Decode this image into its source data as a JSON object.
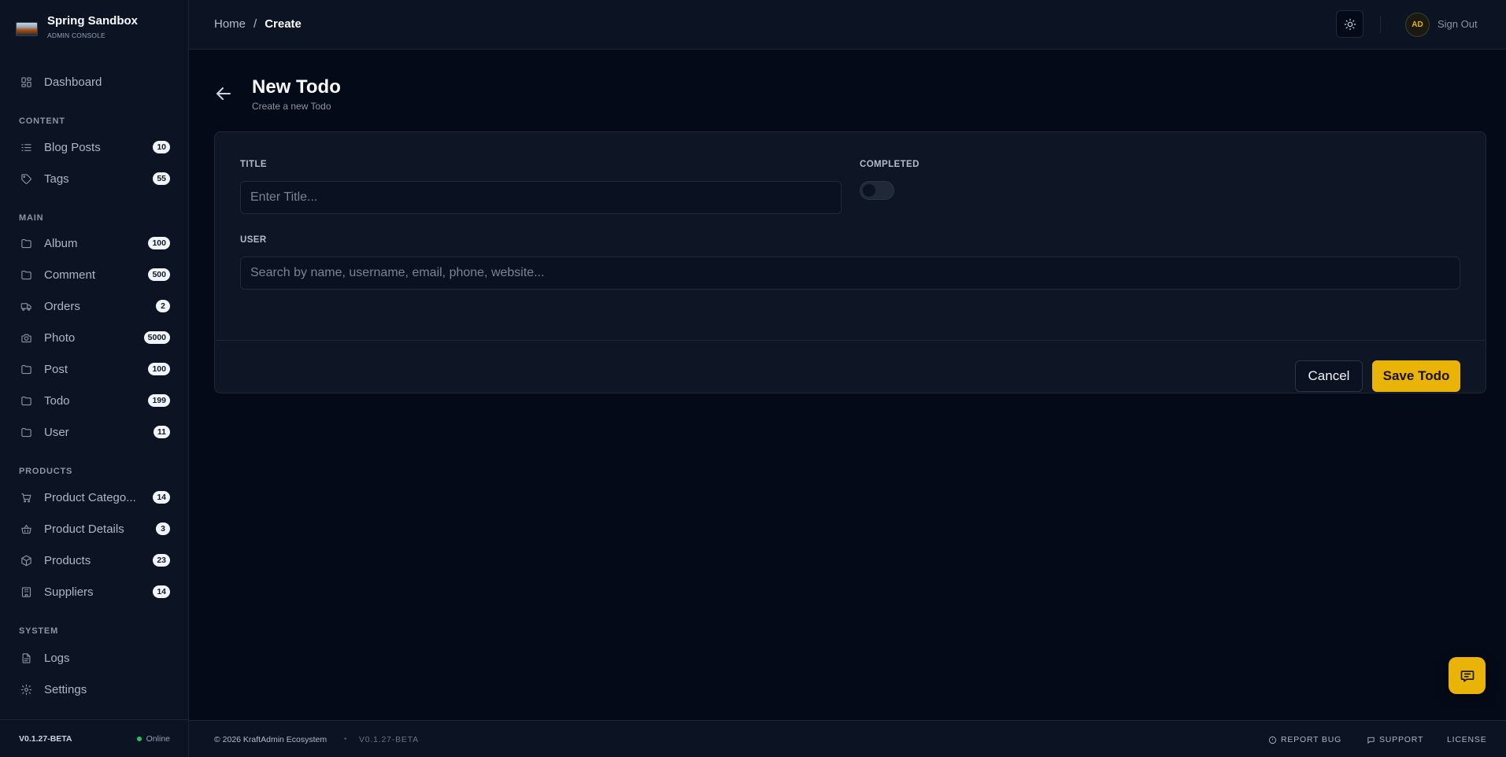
{
  "brand": {
    "title": "Spring Sandbox",
    "subtitle": "ADMIN CONSOLE"
  },
  "sidebar": {
    "dashboard": {
      "label": "Dashboard",
      "icon": "layout-grid-icon"
    },
    "sections": [
      {
        "title": "CONTENT",
        "items": [
          {
            "label": "Blog Posts",
            "badge": "10",
            "icon": "list-icon"
          },
          {
            "label": "Tags",
            "badge": "55",
            "icon": "tag-icon"
          }
        ]
      },
      {
        "title": "MAIN",
        "items": [
          {
            "label": "Album",
            "badge": "100",
            "icon": "folder-icon"
          },
          {
            "label": "Comment",
            "badge": "500",
            "icon": "folder-icon"
          },
          {
            "label": "Orders",
            "badge": "2",
            "icon": "truck-icon"
          },
          {
            "label": "Photo",
            "badge": "5000",
            "icon": "camera-icon"
          },
          {
            "label": "Post",
            "badge": "100",
            "icon": "folder-icon"
          },
          {
            "label": "Todo",
            "badge": "199",
            "icon": "folder-icon"
          },
          {
            "label": "User",
            "badge": "11",
            "icon": "folder-icon"
          }
        ]
      },
      {
        "title": "PRODUCTS",
        "items": [
          {
            "label": "Product Catego...",
            "badge": "14",
            "icon": "cart-icon"
          },
          {
            "label": "Product Details",
            "badge": "3",
            "icon": "basket-icon"
          },
          {
            "label": "Products",
            "badge": "23",
            "icon": "box-icon"
          },
          {
            "label": "Suppliers",
            "badge": "14",
            "icon": "building-icon"
          }
        ]
      },
      {
        "title": "SYSTEM",
        "items": [
          {
            "label": "Logs",
            "icon": "file-text-icon"
          },
          {
            "label": "Settings",
            "icon": "gear-icon"
          }
        ]
      }
    ],
    "footer": {
      "version": "V0.1.27-BETA",
      "status": "Online"
    }
  },
  "header": {
    "breadcrumb": {
      "home": "Home",
      "separator": "/",
      "current": "Create"
    },
    "avatar_initials": "AD",
    "signout": "Sign Out"
  },
  "page": {
    "title": "New Todo",
    "subtitle": "Create a new Todo"
  },
  "form": {
    "title_label": "TITLE",
    "title_placeholder": "Enter Title...",
    "title_value": "",
    "completed_label": "COMPLETED",
    "completed_value": false,
    "user_label": "USER",
    "user_placeholder": "Search by name, username, email, phone, website...",
    "user_value": "",
    "cancel_label": "Cancel",
    "save_label": "Save Todo"
  },
  "footer": {
    "copyright": "© 2026 KraftAdmin Ecosystem",
    "separator": "•",
    "version": "V0.1.27-BETA",
    "report_bug": "REPORT BUG",
    "support": "SUPPORT",
    "license": "LICENSE"
  },
  "colors": {
    "accent": "#eab308",
    "background": "#050a18",
    "panel": "#0c1322",
    "status_online": "#22c55e"
  }
}
